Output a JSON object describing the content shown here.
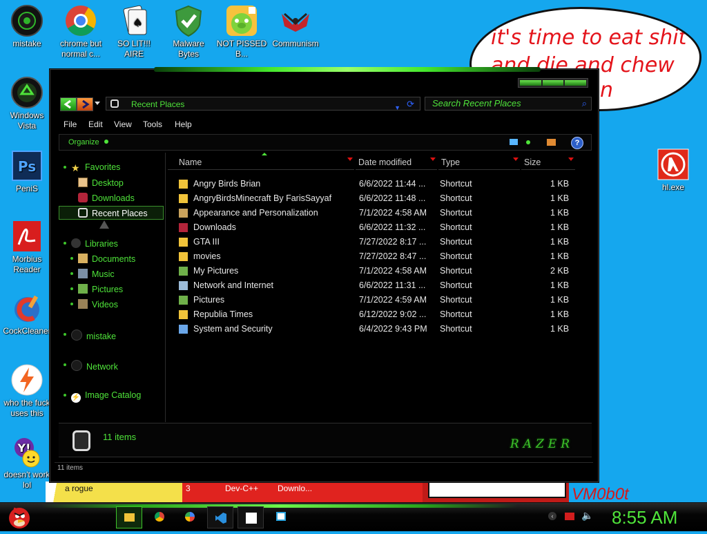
{
  "desktop": {
    "icons": [
      {
        "label": "mistake",
        "icon": "razer-globe-icon"
      },
      {
        "label": "chrome but normal c...",
        "icon": "chrome-icon"
      },
      {
        "label": "SO LIT!!! AIRE",
        "icon": "solitaire-icon"
      },
      {
        "label": "Malware Bytes",
        "icon": "shield-icon"
      },
      {
        "label": "NOT PISSED B...",
        "icon": "angry-pig-icon"
      },
      {
        "label": "Communism",
        "icon": "emblem-icon"
      },
      {
        "label": "Windows Vista",
        "icon": "recycle-icon"
      },
      {
        "label": "PeniS",
        "icon": "photoshop-icon"
      },
      {
        "label": "Morbius Reader",
        "icon": "pdf-icon"
      },
      {
        "label": "CockCleaner",
        "icon": "ccleaner-icon"
      },
      {
        "label": "who the fuck uses this",
        "icon": "lightning-icon"
      },
      {
        "label": "doesn't work lol",
        "icon": "yahoo-messenger-icon"
      },
      {
        "label": "hl.exe",
        "icon": "half-life-icon"
      }
    ],
    "bubble_text": "it's time to eat shit and die and chew",
    "bubble_text_tail": "n",
    "bg_text_rogue": "a rogue",
    "bg_text_three": "3",
    "bg_text_devc": "Dev-C++",
    "bg_text_downlo": "Downlo...",
    "bg_text_vm": "VM0b0t"
  },
  "explorer": {
    "address": "Recent Places",
    "search_placeholder": "Search Recent Places",
    "menu": [
      "File",
      "Edit",
      "View",
      "Tools",
      "Help"
    ],
    "organize": "Organize",
    "nav": {
      "favorites": "Favorites",
      "desktop": "Desktop",
      "downloads": "Downloads",
      "recent_places": "Recent Places",
      "libraries": "Libraries",
      "documents": "Documents",
      "music": "Music",
      "pictures": "Pictures",
      "videos": "Videos",
      "mistake": "mistake",
      "network": "Network",
      "image_catalog": "Image Catalog"
    },
    "columns": {
      "name": "Name",
      "date": "Date modified",
      "type": "Type",
      "size": "Size"
    },
    "files": [
      {
        "name": "Angry Birds Brian",
        "date": "6/6/2022 11:44 ...",
        "type": "Shortcut",
        "size": "1 KB"
      },
      {
        "name": "AngryBirdsMinecraft By FarisSayyaf",
        "date": "6/6/2022 11:48 ...",
        "type": "Shortcut",
        "size": "1 KB"
      },
      {
        "name": "Appearance and Personalization",
        "date": "7/1/2022 4:58 AM",
        "type": "Shortcut",
        "size": "1 KB"
      },
      {
        "name": "Downloads",
        "date": "6/6/2022 11:32 ...",
        "type": "Shortcut",
        "size": "1 KB"
      },
      {
        "name": "GTA III",
        "date": "7/27/2022 8:17 ...",
        "type": "Shortcut",
        "size": "1 KB"
      },
      {
        "name": "movies",
        "date": "7/27/2022 8:47 ...",
        "type": "Shortcut",
        "size": "1 KB"
      },
      {
        "name": "My Pictures",
        "date": "7/1/2022 4:58 AM",
        "type": "Shortcut",
        "size": "2 KB"
      },
      {
        "name": "Network and Internet",
        "date": "6/6/2022 11:31 ...",
        "type": "Shortcut",
        "size": "1 KB"
      },
      {
        "name": "Pictures",
        "date": "7/1/2022 4:59 AM",
        "type": "Shortcut",
        "size": "1 KB"
      },
      {
        "name": "Republia Times",
        "date": "6/12/2022 9:02 ...",
        "type": "Shortcut",
        "size": "1 KB"
      },
      {
        "name": "System and Security",
        "date": "6/4/2022 9:43 PM",
        "type": "Shortcut",
        "size": "1 KB"
      }
    ],
    "details_count": "11 items",
    "status_count": "11 items",
    "brand": "RAZER"
  },
  "taskbar": {
    "clock": "8:55 AM"
  },
  "colors": {
    "accent_green": "#4fe43a",
    "desktop_blue": "#15a7ee",
    "bubble_red": "#e4141b"
  }
}
